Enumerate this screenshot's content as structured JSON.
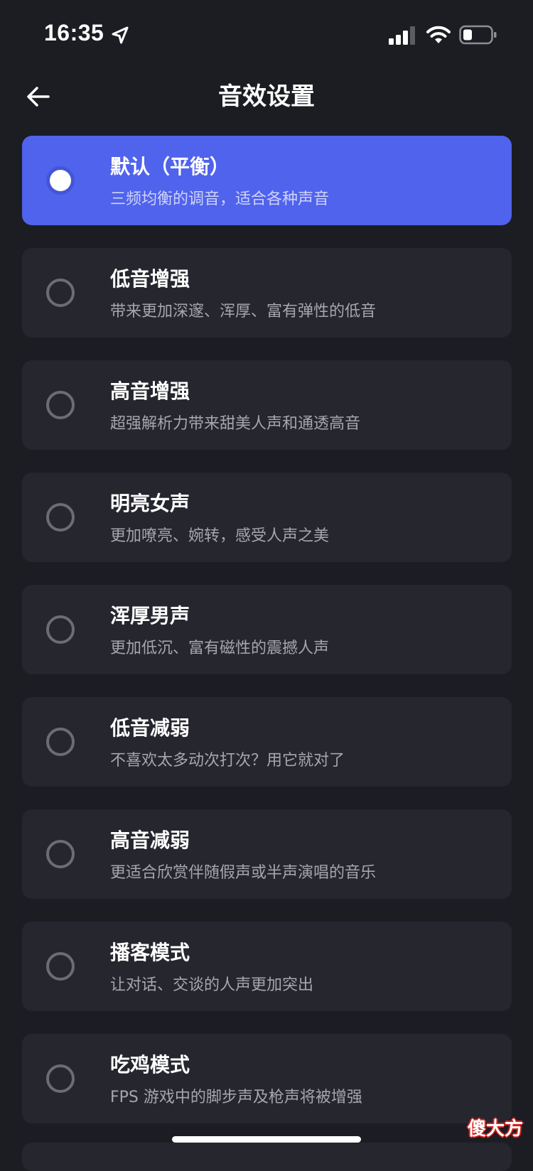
{
  "status_bar": {
    "time": "16:35",
    "icons": [
      "location-arrow-icon",
      "cellular-signal-icon",
      "wifi-icon",
      "battery-icon"
    ]
  },
  "header": {
    "title": "音效设置",
    "back_icon": "arrow-left-icon"
  },
  "colors": {
    "background": "#1c1d23",
    "card": "#25262e",
    "accent": "#5063ec"
  },
  "options": [
    {
      "title": "默认（平衡）",
      "description": "三频均衡的调音，适合各种声音",
      "selected": true
    },
    {
      "title": "低音增强",
      "description": "带来更加深邃、浑厚、富有弹性的低音",
      "selected": false
    },
    {
      "title": "高音增强",
      "description": "超强解析力带来甜美人声和通透高音",
      "selected": false
    },
    {
      "title": "明亮女声",
      "description": "更加嘹亮、婉转，感受人声之美",
      "selected": false
    },
    {
      "title": "浑厚男声",
      "description": "更加低沉、富有磁性的震撼人声",
      "selected": false
    },
    {
      "title": "低音减弱",
      "description": "不喜欢太多动次打次？用它就对了",
      "selected": false
    },
    {
      "title": "高音减弱",
      "description": "更适合欣赏伴随假声或半声演唱的音乐",
      "selected": false
    },
    {
      "title": "播客模式",
      "description": "让对话、交谈的人声更加突出",
      "selected": false
    },
    {
      "title": "吃鸡模式",
      "description": "FPS 游戏中的脚步声及枪声将被增强",
      "selected": false
    }
  ],
  "watermark": "傻大方"
}
